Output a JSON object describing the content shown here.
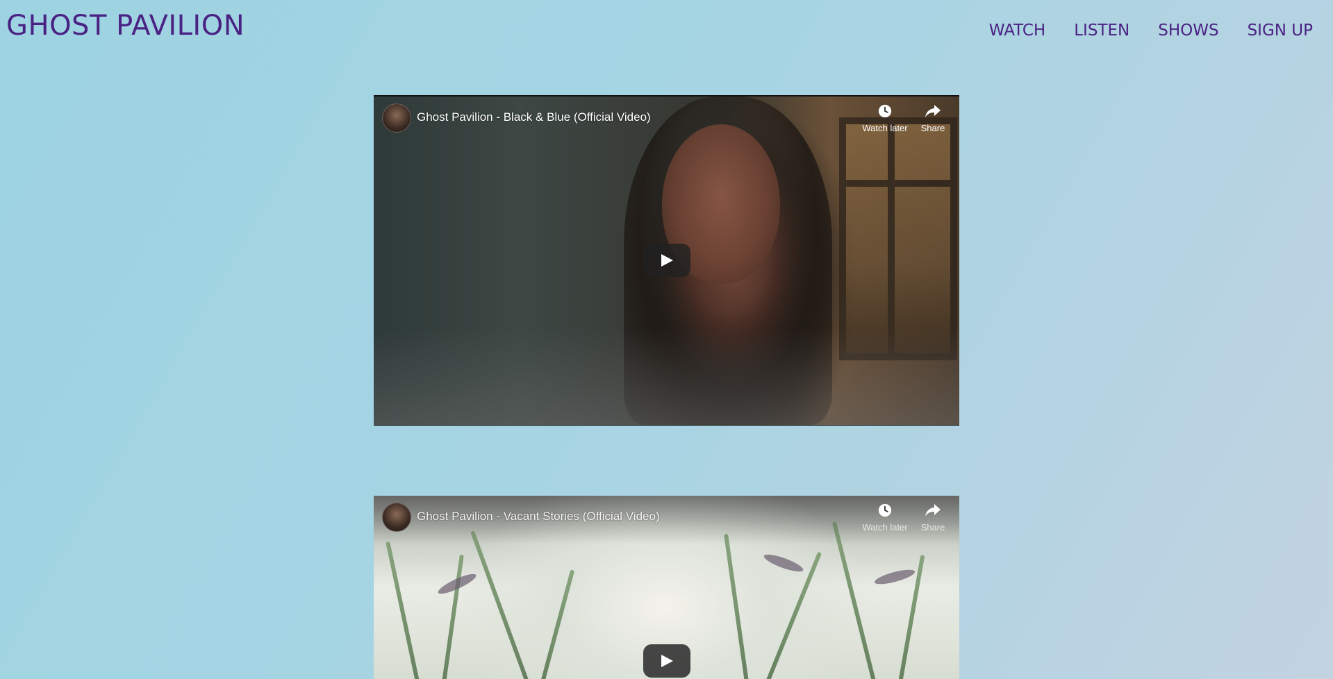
{
  "site": {
    "title": "GHOST PAVILION"
  },
  "nav": {
    "items": [
      {
        "label": "WATCH"
      },
      {
        "label": "LISTEN"
      },
      {
        "label": "SHOWS"
      },
      {
        "label": "SIGN UP"
      }
    ]
  },
  "videos": [
    {
      "title": "Ghost Pavilion - Black & Blue (Official Video)",
      "watch_later_label": "Watch later",
      "share_label": "Share"
    },
    {
      "title": "Ghost Pavilion - Vacant Stories (Official Video)",
      "watch_later_label": "Watch later",
      "share_label": "Share"
    }
  ],
  "colors": {
    "brand": "#4a2283",
    "background": "#9dd3e2",
    "player_button": "#212121"
  },
  "icons": {
    "watch_later": "clock-icon",
    "share": "share-arrow-icon",
    "play": "play-icon"
  }
}
